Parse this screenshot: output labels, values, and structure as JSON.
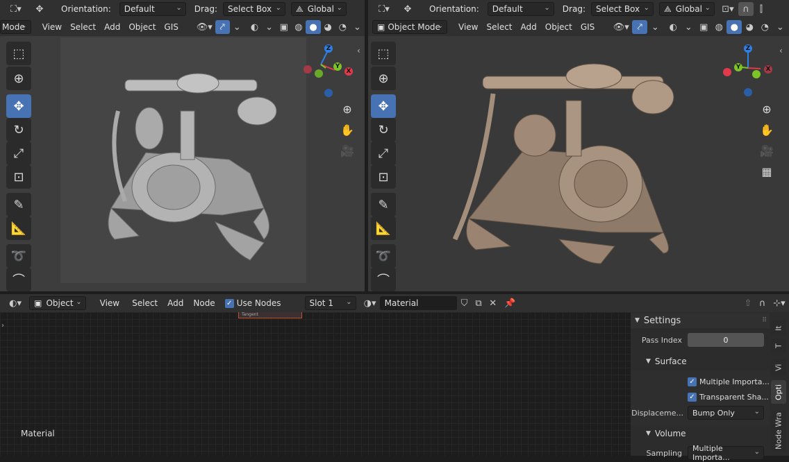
{
  "left_view": {
    "header1": {
      "orientation_label": "Orientation:",
      "orientation_value": "Default",
      "drag_label": "Drag:",
      "drag_value": "Select Box",
      "transform_value": "Global"
    },
    "header2": {
      "mode_value": "Mode",
      "menu": [
        "View",
        "Select",
        "Add",
        "Object",
        "GIS"
      ]
    }
  },
  "right_view": {
    "header1": {
      "orientation_label": "Orientation:",
      "orientation_value": "Default",
      "drag_label": "Drag:",
      "drag_value": "Select Box",
      "transform_value": "Global"
    },
    "header2": {
      "mode_value": "Object Mode",
      "menu": [
        "View",
        "Select",
        "Add",
        "Object",
        "GIS"
      ]
    }
  },
  "gizmo": {
    "x": "X",
    "y": "Y",
    "z": "Z",
    "colors": {
      "x": "#e23a4b",
      "y": "#7cc327",
      "z": "#2f7fe4"
    }
  },
  "node_editor": {
    "header": {
      "object_value": "Object",
      "menu": [
        "View",
        "Select",
        "Add",
        "Node"
      ],
      "use_nodes_label": "Use Nodes",
      "use_nodes_checked": true,
      "slot_value": "Slot 1",
      "material_value": "Material"
    },
    "node_label": "Tangent",
    "canvas_label": "Material"
  },
  "properties": {
    "settings_title": "Settings",
    "pass_index_label": "Pass Index",
    "pass_index_value": "0",
    "surface_title": "Surface",
    "multiple_importance_label": "Multiple Importa...",
    "transparent_shadow_label": "Transparent Sha...",
    "displacement_label": "Displaceme...",
    "displacement_value": "Bump Only",
    "volume_title": "Volume",
    "sampling_label": "Sampling",
    "sampling_value": "Multiple Importa..."
  },
  "side_tabs": [
    "It",
    "T",
    "Vi",
    "Opti",
    "Node Wra"
  ],
  "colors": {
    "accent": "#4772b3",
    "header": "#303030",
    "viewport_left": "#3d3d3d",
    "viewport_right": "#393939"
  }
}
